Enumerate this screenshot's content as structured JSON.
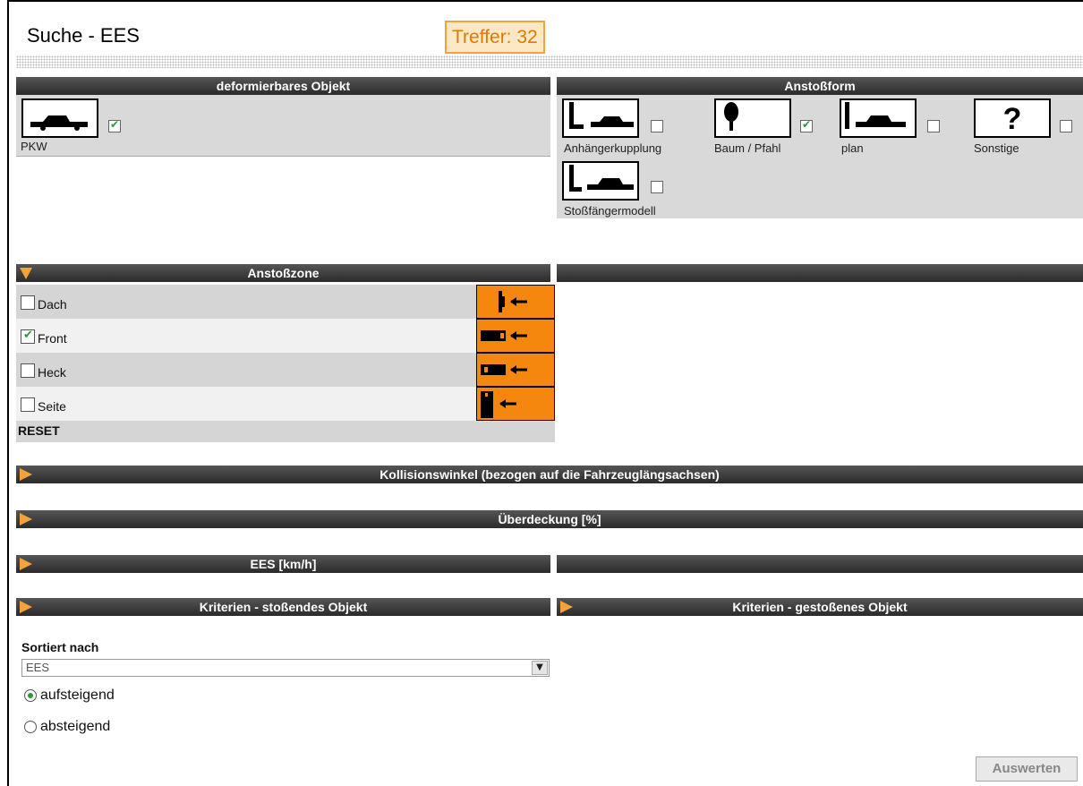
{
  "header": {
    "title": "Suche - EES",
    "treffer": "Treffer: 32"
  },
  "deformierbar": {
    "header": "deformierbares Objekt",
    "items": [
      {
        "label": "PKW",
        "checked": true,
        "icon": "car-icon"
      }
    ]
  },
  "anstossform": {
    "header": "Anstoßform",
    "items": [
      {
        "label": "Anhängerkupplung",
        "checked": false,
        "icon": "trailer-hitch-icon"
      },
      {
        "label": "Baum / Pfahl",
        "checked": true,
        "icon": "tree-icon"
      },
      {
        "label": "plan",
        "checked": false,
        "icon": "flat-wall-icon"
      },
      {
        "label": "Sonstige",
        "checked": false,
        "icon": "question-icon"
      },
      {
        "label": "Stoßfängermodell",
        "checked": false,
        "icon": "bumper-model-icon"
      }
    ]
  },
  "anstosszone": {
    "header": "Anstoßzone",
    "rows": [
      {
        "label": "Dach",
        "checked": false,
        "icon": "roof-impact-icon"
      },
      {
        "label": "Front",
        "checked": true,
        "icon": "front-impact-icon"
      },
      {
        "label": "Heck",
        "checked": false,
        "icon": "rear-impact-icon"
      },
      {
        "label": "Seite",
        "checked": false,
        "icon": "side-impact-icon"
      }
    ],
    "reset": "RESET"
  },
  "sections": {
    "kollisionswinkel": "Kollisionswinkel (bezogen auf die Fahrzeuglängsachsen)",
    "ueberdeckung": "Überdeckung [%]",
    "ees": "EES [km/h]",
    "kriterien_stossend": "Kriterien - stoßendes Objekt",
    "kriterien_gestossen": "Kriterien - gestoßenes Objekt"
  },
  "sort": {
    "label": "Sortiert nach",
    "selected": "EES",
    "options": [
      {
        "label": "aufsteigend",
        "selected": true
      },
      {
        "label": "absteigend",
        "selected": false
      }
    ]
  },
  "auswerten": "Auswerten",
  "colors": {
    "accent": "#f5870f",
    "bar": "#333333",
    "panel": "#d9d9d9",
    "check": "#2a9a3a"
  }
}
